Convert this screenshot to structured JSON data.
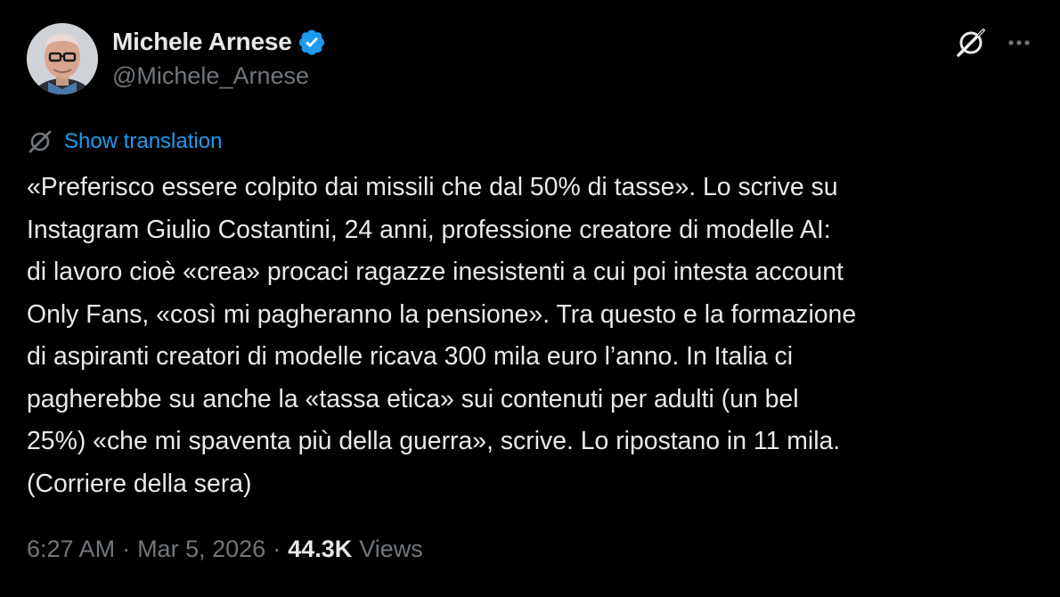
{
  "author": {
    "display_name": "Michele Arnese",
    "handle": "@Michele_Arnese",
    "verified": true,
    "avatar_icon": "profile-photo"
  },
  "translation": {
    "icon": "grok-translate-icon",
    "label": "Show translation"
  },
  "tweet": {
    "text": "«Preferisco essere colpito dai missili che dal 50% di tasse». Lo scrive su\nInstagram Giulio Costantini, 24 anni, professione creatore di modelle AI:\ndi lavoro cioè «crea» procaci ragazze inesistenti a cui poi intesta account\nOnly Fans, «così mi pagheranno la pensione». Tra questo e la formazione\ndi aspiranti creatori di modelle ricava 300 mila euro l’anno. In Italia ci\npagherebbe su anche la «tassa etica» sui contenuti per adulti (un bel\n25%) «che mi spaventa più della guerra», scrive. Lo ripostano in 11 mila.\n(Corriere della sera)"
  },
  "meta": {
    "time": "6:27 AM",
    "separator": "·",
    "date": "Mar 5, 2026",
    "views_count": "44.3K",
    "views_label": "Views"
  },
  "colors": {
    "background": "#000000",
    "text": "#e7e9ea",
    "secondary": "#71767b",
    "accent": "#1d9bf0"
  }
}
